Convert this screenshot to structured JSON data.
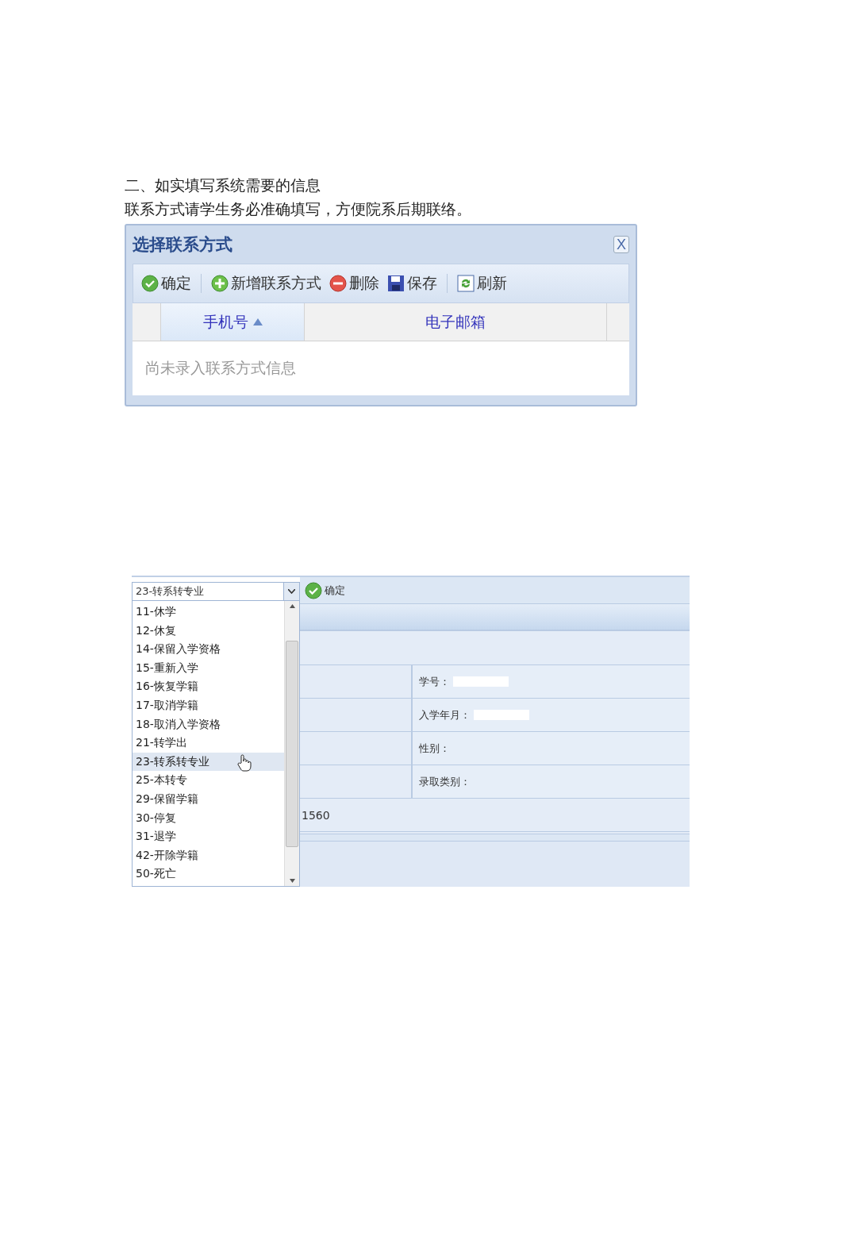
{
  "heading": "二、如实填写系统需要的信息",
  "paragraph": "联系方式请学生务必准确填写，方便院系后期联络。",
  "contact_dialog": {
    "title": "选择联系方式",
    "close": "X",
    "toolbar": [
      {
        "label": "确定",
        "kind": "confirm"
      },
      {
        "label": "新增联系方式",
        "kind": "add"
      },
      {
        "label": "删除",
        "kind": "delete"
      },
      {
        "label": "保存",
        "kind": "save"
      },
      {
        "label": "刷新",
        "kind": "refresh"
      }
    ],
    "columns": [
      {
        "label": "手机号",
        "sorted": true
      },
      {
        "label": "电子邮箱",
        "sorted": false
      }
    ],
    "empty_message": "尚未录入联系方式信息"
  },
  "status_form": {
    "combo": {
      "value": "23-转系转专业"
    },
    "confirm_button": "确定",
    "dropdown": [
      {
        "label": "11-休学",
        "selected": false
      },
      {
        "label": "12-休复",
        "selected": false
      },
      {
        "label": "14-保留入学资格",
        "selected": false
      },
      {
        "label": "15-重新入学",
        "selected": false
      },
      {
        "label": "16-恢复学籍",
        "selected": false
      },
      {
        "label": "17-取消学籍",
        "selected": false
      },
      {
        "label": "18-取消入学资格",
        "selected": false
      },
      {
        "label": "21-转学出",
        "selected": false
      },
      {
        "label": "23-转系转专业",
        "selected": true
      },
      {
        "label": "25-本转专",
        "selected": false
      },
      {
        "label": "29-保留学籍",
        "selected": false
      },
      {
        "label": "30-停复",
        "selected": false
      },
      {
        "label": "31-退学",
        "selected": false
      },
      {
        "label": "42-开除学籍",
        "selected": false
      },
      {
        "label": "50-死亡",
        "selected": false
      }
    ],
    "fields": [
      {
        "label": "学号：",
        "redacted": true
      },
      {
        "label": "入学年月：",
        "redacted": true
      },
      {
        "label": "性别：",
        "redacted": false
      },
      {
        "label": "录取类别：",
        "redacted": false
      }
    ],
    "number": "1560"
  }
}
